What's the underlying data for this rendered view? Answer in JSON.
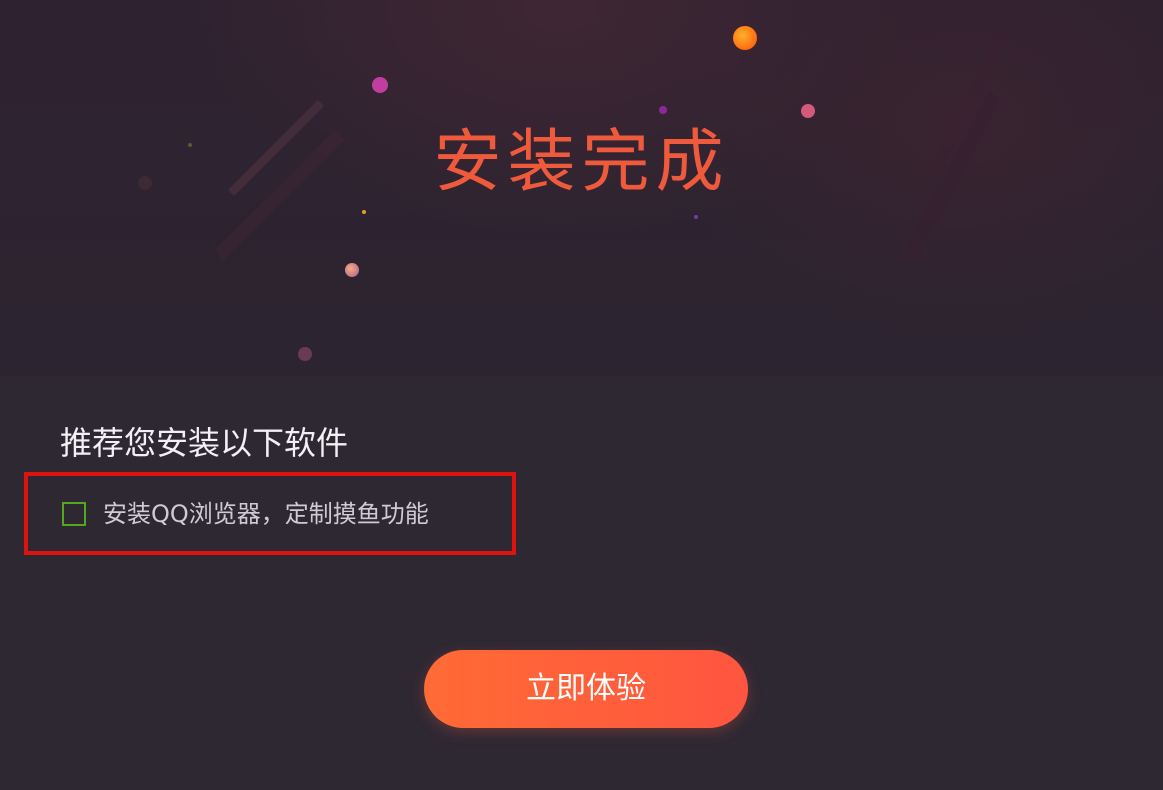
{
  "banner": {
    "title": "安装完成"
  },
  "recommend": {
    "heading": "推荐您安装以下软件",
    "option": {
      "label": "安装QQ浏览器，定制摸鱼功能",
      "checked": false
    }
  },
  "actions": {
    "primary_label": "立即体验"
  },
  "colors": {
    "background": "#2e2833",
    "title": "#f05a3c",
    "accent_start": "#ff6b35",
    "accent_end": "#ff5540",
    "checkbox_border": "#55a51e",
    "highlight_border": "#e01111"
  }
}
